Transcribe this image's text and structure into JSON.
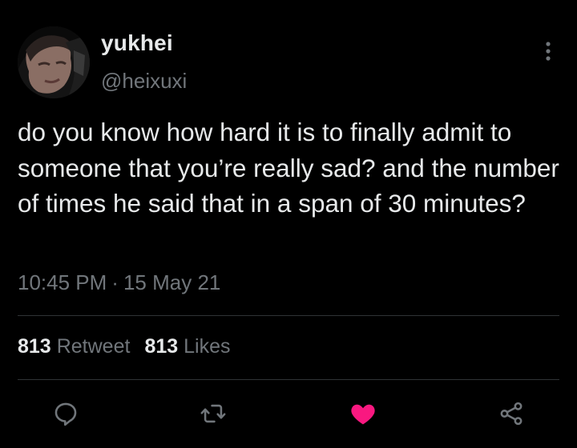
{
  "user": {
    "display_name": "yukhei",
    "handle": "@heixuxi"
  },
  "tweet": {
    "text": "do you know how hard it is to finally admit to someone that you’re really sad? and the number of times he said that in a span of 30 minutes?",
    "time": "10:45 PM",
    "separator": "·",
    "date": "15 May 21"
  },
  "stats": {
    "retweets_count": "813",
    "retweets_label": "Retweet",
    "likes_count": "813",
    "likes_label": "Likes"
  },
  "actions": [
    {
      "icon": "reply-icon"
    },
    {
      "icon": "retweet-icon"
    },
    {
      "icon": "heart-icon",
      "active": true
    },
    {
      "icon": "share-icon"
    }
  ],
  "colors": {
    "background": "#000000",
    "text": "#e7e9ea",
    "secondary_text": "#71767b",
    "divider": "#2f3336",
    "like_active": "#f91880"
  }
}
